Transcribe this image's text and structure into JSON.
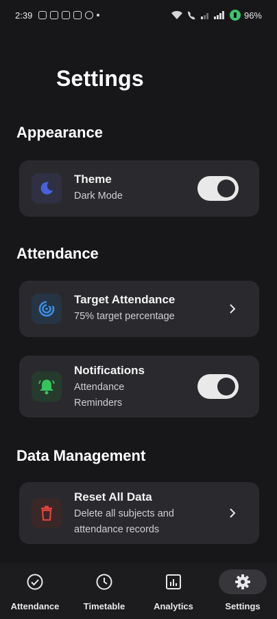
{
  "status_bar": {
    "time": "2:39",
    "battery": "96%"
  },
  "page": {
    "title": "Settings"
  },
  "sections": {
    "appearance": "Appearance",
    "attendance": "Attendance",
    "data_management": "Data Management"
  },
  "cards": {
    "theme": {
      "title": "Theme",
      "subtitle": "Dark Mode",
      "toggle_on": true,
      "icon": "moon-icon",
      "icon_color": "#4a5fe0",
      "icon_bg": "#2f3142"
    },
    "target": {
      "title": "Target Attendance",
      "subtitle": "75% target percentage",
      "icon": "target-icon",
      "icon_color": "#3b8fe8",
      "icon_bg": "#263444"
    },
    "notifications": {
      "title": "Notifications",
      "subtitle_line1": "Attendance",
      "subtitle_line2": "Reminders",
      "toggle_on": true,
      "icon": "bell-icon",
      "icon_color": "#37c45a",
      "icon_bg": "#263a2e"
    },
    "reset": {
      "title": "Reset All Data",
      "subtitle_line1": "Delete all subjects and",
      "subtitle_line2": "attendance records",
      "icon": "trash-icon",
      "icon_color": "#e2443f",
      "icon_bg": "#3a2728"
    }
  },
  "bottom_nav": {
    "items": [
      {
        "label": "Attendance",
        "icon": "check-circle-icon",
        "active": false
      },
      {
        "label": "Timetable",
        "icon": "clock-icon",
        "active": false
      },
      {
        "label": "Analytics",
        "icon": "analytics-icon",
        "active": false
      },
      {
        "label": "Settings",
        "icon": "gear-icon",
        "active": true
      }
    ]
  }
}
